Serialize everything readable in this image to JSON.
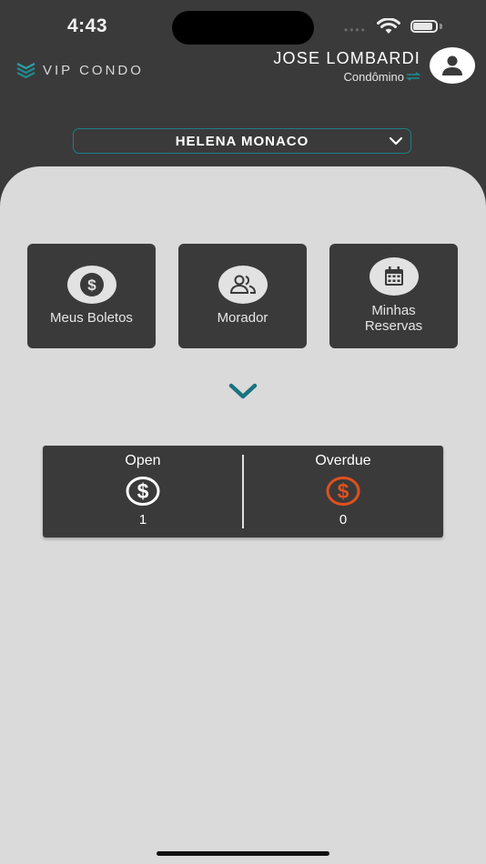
{
  "status_bar": {
    "time": "4:43",
    "signal_dots": "••••"
  },
  "header": {
    "app_name": "VIP CONDO",
    "user_name": "JOSE LOMBARDI",
    "user_role": "Condômino",
    "accent_color": "#1f7f86"
  },
  "unit_selector": {
    "selected": "HELENA MONACO",
    "icon": "chevron-down-icon"
  },
  "tiles": [
    {
      "label": "Meus Boletos",
      "icon": "dollar-icon"
    },
    {
      "label": "Morador",
      "icon": "people-icon"
    },
    {
      "label": "Minhas\nReservas",
      "icon": "calendar-icon"
    }
  ],
  "expand": {
    "icon": "chevron-down-icon",
    "color": "#1a7380"
  },
  "summary": {
    "open": {
      "title": "Open",
      "count": "1",
      "icon": "dollar-circle-icon",
      "color": "#ffffff"
    },
    "overdue": {
      "title": "Overdue",
      "count": "0",
      "icon": "dollar-circle-icon",
      "color": "#e0501f"
    }
  }
}
